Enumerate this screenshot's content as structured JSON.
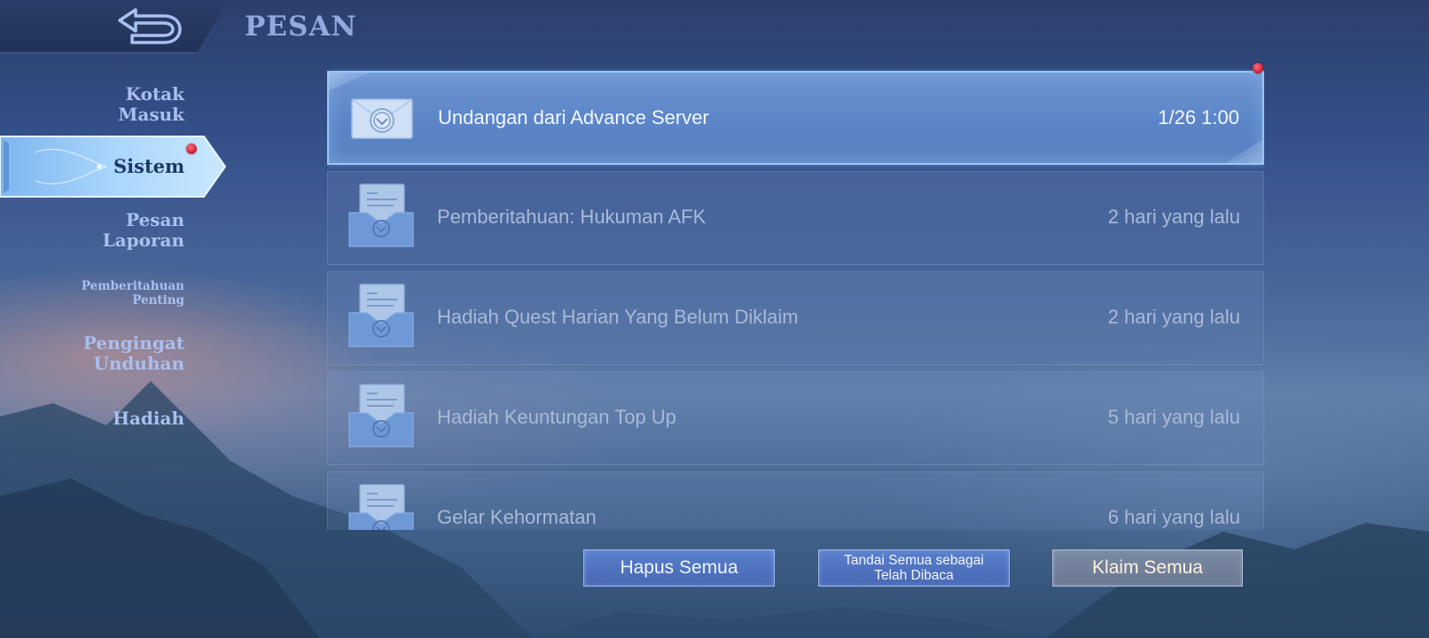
{
  "header": {
    "title": "PESAN",
    "back_icon": "back-arrow-icon"
  },
  "sidebar": {
    "items": [
      {
        "label_line1": "Kotak",
        "label_line2": "Masuk"
      },
      {
        "label": "Sistem",
        "active": true,
        "has_notification": true
      },
      {
        "label_line1": "Pesan",
        "label_line2": "Laporan"
      },
      {
        "label_line1": "Pemberitahuan",
        "label_line2": "Penting"
      },
      {
        "label_line1": "Pengingat",
        "label_line2": "Unduhan"
      },
      {
        "label": "Hadiah"
      }
    ]
  },
  "messages": [
    {
      "title": "Undangan dari Advance Server",
      "time": "1/26 1:00",
      "unread": true,
      "icon": "envelope-closed-icon"
    },
    {
      "title": "Pemberitahuan: Hukuman AFK",
      "time": "2 hari yang lalu",
      "unread": false,
      "icon": "envelope-open-icon"
    },
    {
      "title": "Hadiah Quest Harian Yang Belum Diklaim",
      "time": "2 hari yang lalu",
      "unread": false,
      "icon": "envelope-open-icon"
    },
    {
      "title": "Hadiah Keuntungan Top Up",
      "time": "5 hari yang lalu",
      "unread": false,
      "icon": "envelope-open-icon"
    },
    {
      "title": "Gelar Kehormatan",
      "time": "6 hari yang lalu",
      "unread": false,
      "icon": "envelope-open-icon"
    }
  ],
  "actions": {
    "delete_all": "Hapus Semua",
    "mark_all_read_line1": "Tandai Semua sebagai",
    "mark_all_read_line2": "Telah Dibaca",
    "claim_all": "Klaim Semua"
  },
  "colors": {
    "unread_row": "#5b85c8",
    "accent_text": "#93a9dd",
    "notification_dot": "#c21f35"
  }
}
